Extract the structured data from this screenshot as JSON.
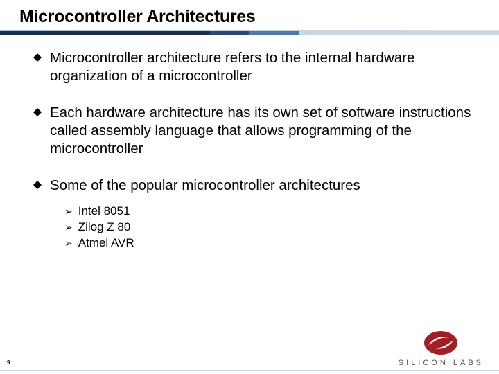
{
  "slide": {
    "title": "Microcontroller Architectures",
    "bullets": [
      "Microcontroller architecture refers to the internal hardware organization of a microcontroller",
      "Each hardware architecture has its own set of software instructions called assembly language that allows programming of the microcontroller",
      "Some of the popular microcontroller architectures"
    ],
    "sub_bullets": [
      "Intel 8051",
      "Zilog Z 80",
      "Atmel AVR"
    ],
    "page_number": "9",
    "logo_text": "SILICON LABS"
  }
}
